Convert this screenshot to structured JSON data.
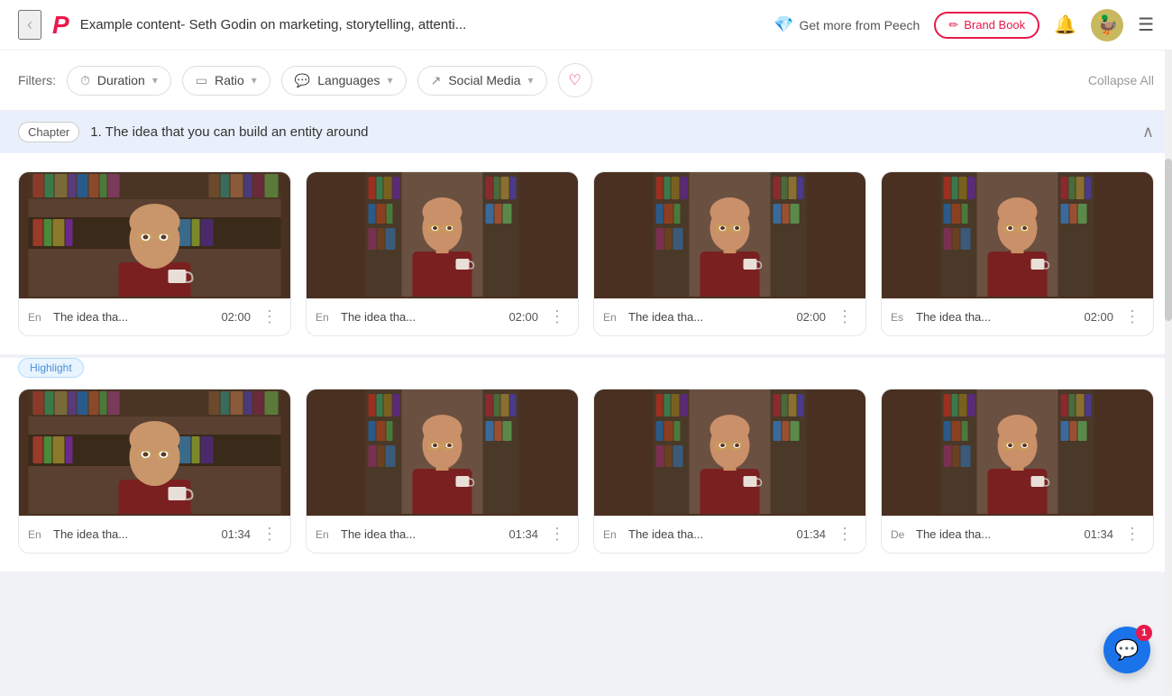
{
  "header": {
    "back_label": "‹",
    "logo": "P",
    "title": "Example content- Seth Godin on marketing, storytelling, attenti...",
    "get_more_label": "Get more from Peech",
    "brand_book_label": "Brand Book",
    "diamond_icon": "💎",
    "pen_icon": "✏",
    "bell_icon": "🔔",
    "menu_icon": "☰"
  },
  "filters": {
    "label": "Filters:",
    "duration": {
      "label": "Duration",
      "icon": "⏱"
    },
    "ratio": {
      "label": "Ratio",
      "icon": "▭"
    },
    "languages": {
      "label": "Languages",
      "icon": "💬"
    },
    "social_media": {
      "label": "Social Media",
      "icon": "↗"
    },
    "collapse_all": "Collapse All"
  },
  "chapter": {
    "tag": "Chapter",
    "title": "1. The idea that you can build an entity around"
  },
  "highlight_tag": "Highlight",
  "videos_row1": [
    {
      "lang": "En",
      "title": "The idea tha...",
      "duration": "02:00",
      "wide": true
    },
    {
      "lang": "En",
      "title": "The idea tha...",
      "duration": "02:00",
      "wide": false
    },
    {
      "lang": "En",
      "title": "The idea tha...",
      "duration": "02:00",
      "wide": false
    },
    {
      "lang": "Es",
      "title": "The idea tha...",
      "duration": "02:00",
      "wide": false
    }
  ],
  "videos_row2": [
    {
      "lang": "En",
      "title": "The idea tha...",
      "duration": "01:34",
      "wide": true
    },
    {
      "lang": "En",
      "title": "The idea tha...",
      "duration": "01:34",
      "wide": false
    },
    {
      "lang": "En",
      "title": "The idea tha...",
      "duration": "01:34",
      "wide": false
    },
    {
      "lang": "De",
      "title": "The idea tha...",
      "duration": "01:34",
      "wide": false
    }
  ],
  "chat": {
    "badge": "1",
    "icon": "💬"
  },
  "colors": {
    "accent": "#e8194b",
    "purple": "#a855f7",
    "blue": "#1a73e8"
  }
}
